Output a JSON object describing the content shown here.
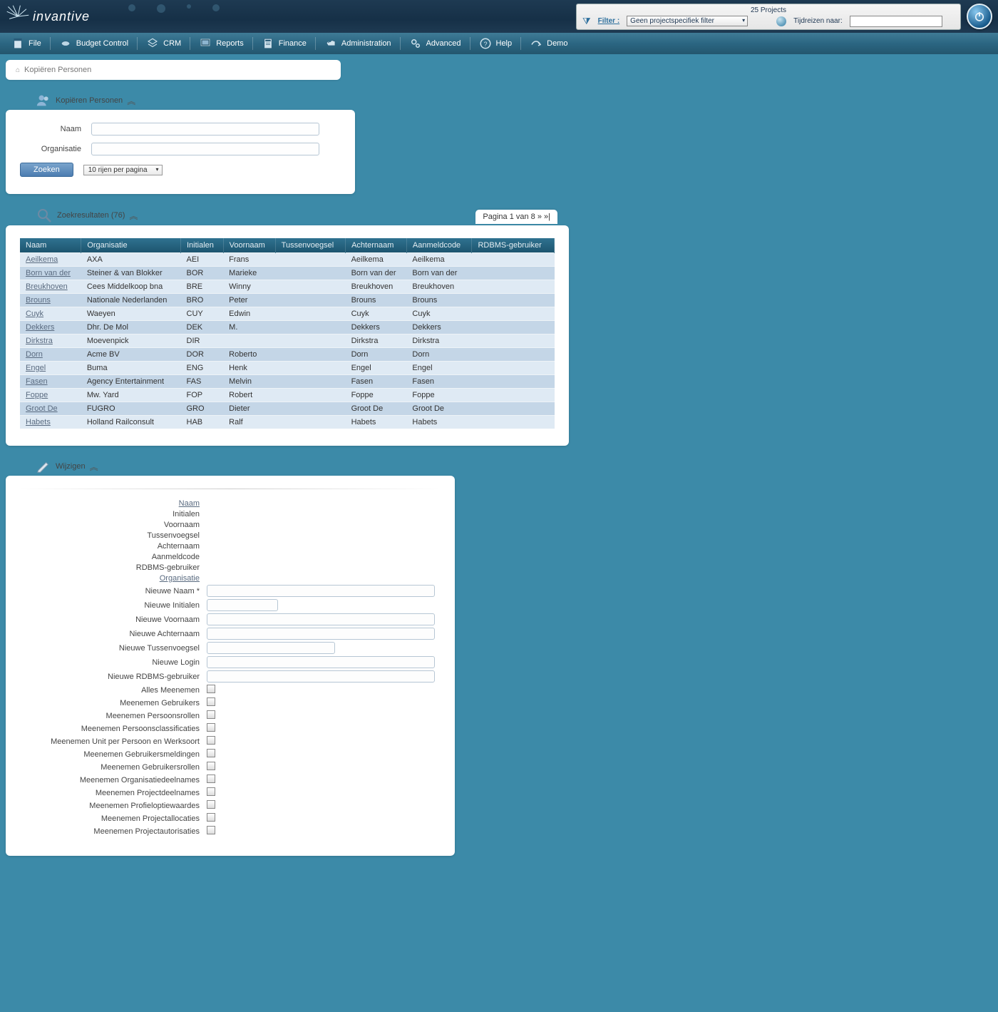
{
  "header": {
    "projects_count": "25 Projects",
    "filter_label": "Filter :",
    "filter_value": "Geen projectspecifiek filter",
    "travel_label": "Tijdreizen naar:",
    "travel_value": "",
    "logo_text": "invantive"
  },
  "menu": [
    {
      "label": "File"
    },
    {
      "label": "Budget Control"
    },
    {
      "label": "CRM"
    },
    {
      "label": "Reports"
    },
    {
      "label": "Finance"
    },
    {
      "label": "Administration"
    },
    {
      "label": "Advanced"
    },
    {
      "label": "Help"
    },
    {
      "label": "Demo"
    }
  ],
  "breadcrumb": {
    "title": "Kopiëren Personen"
  },
  "search_panel": {
    "title": "Kopiëren Personen",
    "name_label": "Naam",
    "org_label": "Organisatie",
    "search_btn": "Zoeken",
    "rows_select": "10 rijen per pagina"
  },
  "results_panel": {
    "title": "Zoekresultaten (76)",
    "pagination": "Pagina 1 van 8  »  »|",
    "headers": [
      "Naam",
      "Organisatie",
      "Initialen",
      "Voornaam",
      "Tussenvoegsel",
      "Achternaam",
      "Aanmeldcode",
      "RDBMS-gebruiker"
    ],
    "rows": [
      {
        "naam": "Aeilkema",
        "org": "AXA",
        "init": "AEI",
        "voor": "Frans",
        "tussen": "",
        "achter": "Aeilkema",
        "aanmeld": "Aeilkema",
        "rdbms": ""
      },
      {
        "naam": "Born van der",
        "org": "Steiner & van Blokker",
        "init": "BOR",
        "voor": "Marieke",
        "tussen": "",
        "achter": "Born van der",
        "aanmeld": "Born van der",
        "rdbms": ""
      },
      {
        "naam": "Breukhoven",
        "org": "Cees Middelkoop bna",
        "init": "BRE",
        "voor": "Winny",
        "tussen": "",
        "achter": "Breukhoven",
        "aanmeld": "Breukhoven",
        "rdbms": ""
      },
      {
        "naam": "Brouns",
        "org": "Nationale Nederlanden",
        "init": "BRO",
        "voor": "Peter",
        "tussen": "",
        "achter": "Brouns",
        "aanmeld": "Brouns",
        "rdbms": ""
      },
      {
        "naam": "Cuyk",
        "org": "Waeyen",
        "init": "CUY",
        "voor": "Edwin",
        "tussen": "",
        "achter": "Cuyk",
        "aanmeld": "Cuyk",
        "rdbms": ""
      },
      {
        "naam": "Dekkers",
        "org": "Dhr. De Mol",
        "init": "DEK",
        "voor": "M.",
        "tussen": "",
        "achter": "Dekkers",
        "aanmeld": "Dekkers",
        "rdbms": ""
      },
      {
        "naam": "Dirkstra",
        "org": "Moevenpick",
        "init": "DIR",
        "voor": "",
        "tussen": "",
        "achter": "Dirkstra",
        "aanmeld": "Dirkstra",
        "rdbms": ""
      },
      {
        "naam": "Dorn",
        "org": "Acme BV",
        "init": "DOR",
        "voor": "Roberto",
        "tussen": "",
        "achter": "Dorn",
        "aanmeld": "Dorn",
        "rdbms": ""
      },
      {
        "naam": "Engel",
        "org": "Buma",
        "init": "ENG",
        "voor": "Henk",
        "tussen": "",
        "achter": "Engel",
        "aanmeld": "Engel",
        "rdbms": ""
      },
      {
        "naam": "Fasen",
        "org": "Agency Entertainment",
        "init": "FAS",
        "voor": "Melvin",
        "tussen": "",
        "achter": "Fasen",
        "aanmeld": "Fasen",
        "rdbms": ""
      },
      {
        "naam": "Foppe",
        "org": "Mw. Yard",
        "init": "FOP",
        "voor": "Robert",
        "tussen": "",
        "achter": "Foppe",
        "aanmeld": "Foppe",
        "rdbms": ""
      },
      {
        "naam": "Groot De",
        "org": "FUGRO",
        "init": "GRO",
        "voor": "Dieter",
        "tussen": "",
        "achter": "Groot De",
        "aanmeld": "Groot De",
        "rdbms": ""
      },
      {
        "naam": "Habets",
        "org": "Holland Railconsult",
        "init": "HAB",
        "voor": "Ralf",
        "tussen": "",
        "achter": "Habets",
        "aanmeld": "Habets",
        "rdbms": ""
      }
    ]
  },
  "edit_panel": {
    "title": "Wijzigen",
    "readonly_fields": [
      {
        "label": "Naam",
        "link": true
      },
      {
        "label": "Initialen",
        "link": false
      },
      {
        "label": "Voornaam",
        "link": false
      },
      {
        "label": "Tussenvoegsel",
        "link": false
      },
      {
        "label": "Achternaam",
        "link": false
      },
      {
        "label": "Aanmeldcode",
        "link": false
      },
      {
        "label": "RDBMS-gebruiker",
        "link": false
      },
      {
        "label": "Organisatie",
        "link": true
      }
    ],
    "input_fields": [
      {
        "label": "Nieuwe Naam *",
        "size": "long"
      },
      {
        "label": "Nieuwe Initialen",
        "size": "short"
      },
      {
        "label": "Nieuwe Voornaam",
        "size": "long"
      },
      {
        "label": "Nieuwe Achternaam",
        "size": "long"
      },
      {
        "label": "Nieuwe Tussenvoegsel",
        "size": "mid"
      },
      {
        "label": "Nieuwe Login",
        "size": "long"
      },
      {
        "label": "Nieuwe RDBMS-gebruiker",
        "size": "long"
      }
    ],
    "check_fields": [
      "Alles Meenemen",
      "Meenemen Gebruikers",
      "Meenemen Persoonsrollen",
      "Meenemen Persoonsclassificaties",
      "Meenemen Unit per Persoon en Werksoort",
      "Meenemen Gebruikersmeldingen",
      "Meenemen Gebruikersrollen",
      "Meenemen Organisatiedeelnames",
      "Meenemen Projectdeelnames",
      "Meenemen Profieloptiewaardes",
      "Meenemen Projectallocaties",
      "Meenemen Projectautorisaties"
    ]
  }
}
